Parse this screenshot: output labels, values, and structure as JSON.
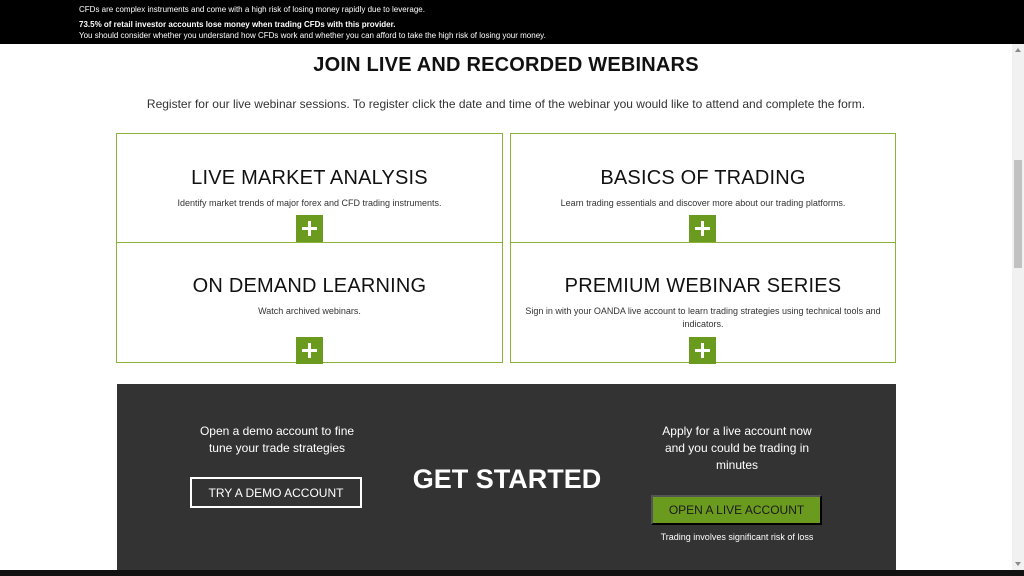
{
  "risk_banner": {
    "line1": "CFDs are complex instruments and come with a high risk of losing money rapidly due to leverage.",
    "line2": "73.5% of retail investor accounts lose money when trading CFDs with this provider.",
    "line3": "You should consider whether you understand how CFDs work and whether you can afford to take the high risk of losing your money."
  },
  "heading": {
    "title": "JOIN LIVE AND RECORDED WEBINARS",
    "intro": "Register for our live webinar sessions. To register click the date and time of the webinar you would like to attend and complete the form."
  },
  "cards": [
    {
      "title": "LIVE MARKET ANALYSIS",
      "description": "Identify market trends of major forex and CFD trading instruments.",
      "expand_icon": "plus-icon"
    },
    {
      "title": "BASICS OF TRADING",
      "description": "Learn trading essentials and discover more about our trading platforms.",
      "expand_icon": "plus-icon"
    },
    {
      "title": "ON DEMAND LEARNING",
      "description": "Watch archived webinars.",
      "expand_icon": "plus-icon"
    },
    {
      "title": "PREMIUM WEBINAR SERIES",
      "description": "Sign in with your OANDA live account to learn trading strategies using technical tools and indicators.",
      "expand_icon": "plus-icon"
    }
  ],
  "cta": {
    "demo_text": "Open a demo account to fine tune your trade strategies",
    "demo_button": "TRY A DEMO ACCOUNT",
    "title": "GET STARTED",
    "live_text": "Apply for a live account now and you could be trading in minutes",
    "live_button": "OPEN A LIVE ACCOUNT",
    "risk_note": "Trading involves significant risk of loss"
  },
  "colors": {
    "accent_green": "#6b9b1e",
    "card_border": "#8bb33a",
    "panel_background": "#333333",
    "banner_background": "#000000"
  }
}
